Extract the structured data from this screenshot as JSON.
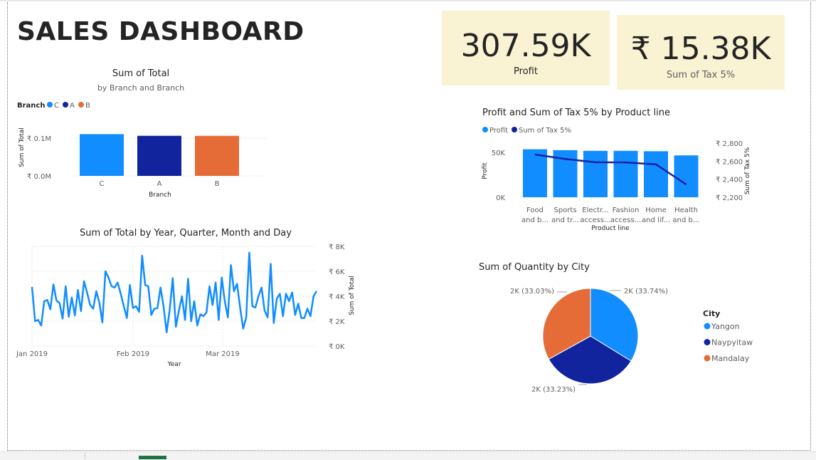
{
  "dashboard": {
    "title": "SALES DASHBOARD"
  },
  "cards": {
    "profit": {
      "value": "307.59K",
      "label": "Profit"
    },
    "tax": {
      "value": "₹ 15.38K",
      "label": "Sum of Tax 5%"
    }
  },
  "colors": {
    "light_blue": "#118dff",
    "dark_blue": "#12239e",
    "orange": "#e66c37",
    "card_bg": "#f9f2d3"
  },
  "chart_data": [
    {
      "id": "branch",
      "type": "bar",
      "title": "Sum of Total",
      "subtitle": "by Branch and Branch",
      "legend_title": "Branch",
      "legend": [
        "C",
        "A",
        "B"
      ],
      "categories": [
        "C",
        "A",
        "B"
      ],
      "values": [
        110568.7,
        106200.4,
        106197.7
      ],
      "xlabel": "Branch",
      "ylabel": "Sum of Total",
      "yticks": [
        "₹ 0.0M",
        "₹ 0.1M"
      ],
      "ylim": [
        0,
        100000
      ]
    },
    {
      "id": "timeseries",
      "type": "line",
      "title": "Sum of Total by Year, Quarter, Month and Day",
      "xlabel": "Year",
      "ylabel": "Sum of Total",
      "xticks": [
        "Jan 2019",
        "Feb 2019",
        "Mar 2019"
      ],
      "yticks": [
        "₹ 0K",
        "₹ 2K",
        "₹ 4K",
        "₹ 6K",
        "₹ 8K"
      ],
      "ylim": [
        0,
        8000
      ],
      "values": [
        4750,
        2000,
        2100,
        1650,
        3600,
        3700,
        2950,
        4950,
        3650,
        3450,
        2200,
        4800,
        2350,
        3900,
        2450,
        4500,
        2800,
        5200,
        4300,
        3300,
        3000,
        4400,
        3500,
        1900,
        6000,
        5500,
        4800,
        4700,
        5100,
        4200,
        3200,
        2250,
        4900,
        3050,
        3200,
        2750,
        7250,
        4900,
        4800,
        2500,
        3000,
        3050,
        4700,
        3200,
        1100,
        2900,
        5450,
        1550,
        2850,
        4000,
        2100,
        5400,
        2000,
        3600,
        1650,
        2550,
        2400,
        2700,
        4800,
        3300,
        5100,
        2100,
        5500,
        3600,
        2300,
        6500,
        4400,
        5000,
        3100,
        1400,
        2300,
        7500,
        3200,
        3100,
        4000,
        4700,
        2850,
        2300,
        6600,
        1850,
        3800,
        4200,
        2400,
        4200,
        3600,
        4300,
        2500,
        3400,
        2250,
        2250,
        3000,
        2400,
        4000,
        4400
      ]
    },
    {
      "id": "productline",
      "type": "bar",
      "title": "Profit and Sum of Tax 5% by Product line",
      "legend": [
        "Profit",
        "Sum of Tax 5%"
      ],
      "xlabel": "Product line",
      "ylabel": "Profit",
      "y2label": "Sum of Tax 5%",
      "categories": [
        [
          "Food",
          "and b..."
        ],
        [
          "Sports",
          "and tr..."
        ],
        [
          "Electr...",
          "access..."
        ],
        [
          "Fashion",
          "access..."
        ],
        [
          "Home",
          "and lif..."
        ],
        [
          "Health",
          "and b..."
        ]
      ],
      "yticks": [
        "0K",
        "50K"
      ],
      "y2ticks": [
        "₹ 2,200",
        "₹ 2,400",
        "₹ 2,600",
        "₹ 2,800"
      ],
      "series": [
        {
          "name": "Profit",
          "values": [
            53470,
            52500,
            51750,
            51720,
            51300,
            46650
          ]
        },
        {
          "name": "Sum of Tax 5%",
          "values": [
            2674,
            2625,
            2588,
            2586,
            2565,
            2343
          ]
        }
      ],
      "ylim": [
        0,
        60000
      ],
      "y2lim": [
        2200,
        2800
      ]
    },
    {
      "id": "city",
      "type": "pie",
      "title": "Sum of Quantity by City",
      "legend_title": "City",
      "labels": [
        "Yangon",
        "Naypyitaw",
        "Mandalay"
      ],
      "values": [
        33.74,
        33.23,
        33.03
      ],
      "data_labels": [
        "2K (33.74%)",
        "2K (33.23%)",
        "2K (33.03%)"
      ]
    }
  ]
}
